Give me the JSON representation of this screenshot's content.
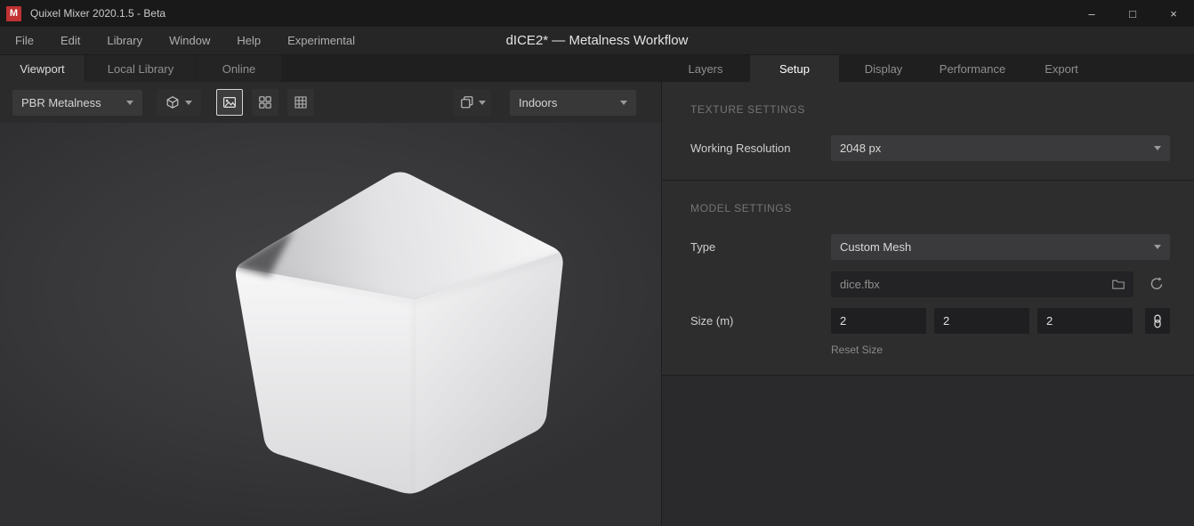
{
  "titlebar": {
    "logo_letter": "M",
    "app_title": "Quixel Mixer 2020.1.5 - Beta",
    "controls": {
      "minimize": "–",
      "maximize": "□",
      "close": "×"
    }
  },
  "menubar": {
    "items": [
      "File",
      "Edit",
      "Library",
      "Window",
      "Help",
      "Experimental"
    ],
    "document_title": "dICE2* — Metalness Workflow"
  },
  "tabs": {
    "left": [
      {
        "label": "Viewport",
        "active": true
      },
      {
        "label": "Local Library",
        "active": false
      },
      {
        "label": "Online",
        "active": false
      }
    ],
    "right": [
      {
        "label": "Layers",
        "active": false
      },
      {
        "label": "Setup",
        "active": true
      },
      {
        "label": "Display",
        "active": false
      },
      {
        "label": "Performance",
        "active": false
      },
      {
        "label": "Export",
        "active": false
      }
    ]
  },
  "toolbar": {
    "shading_mode": "PBR Metalness",
    "environment": "Indoors"
  },
  "setup_panel": {
    "texture_settings": {
      "heading": "TEXTURE SETTINGS",
      "working_resolution_label": "Working Resolution",
      "working_resolution_value": "2048 px"
    },
    "model_settings": {
      "heading": "MODEL SETTINGS",
      "type_label": "Type",
      "type_value": "Custom Mesh",
      "mesh_file_name": "dice.fbx",
      "size_label": "Size (m)",
      "size_x": "2",
      "size_y": "2",
      "size_z": "2",
      "reset_size_label": "Reset Size"
    }
  },
  "colors": {
    "accent_red": "#c13232",
    "panel_bg": "#2d2d2d",
    "viewport_bg": "#3a3a3c",
    "active_tab_text": "#ffffff"
  }
}
